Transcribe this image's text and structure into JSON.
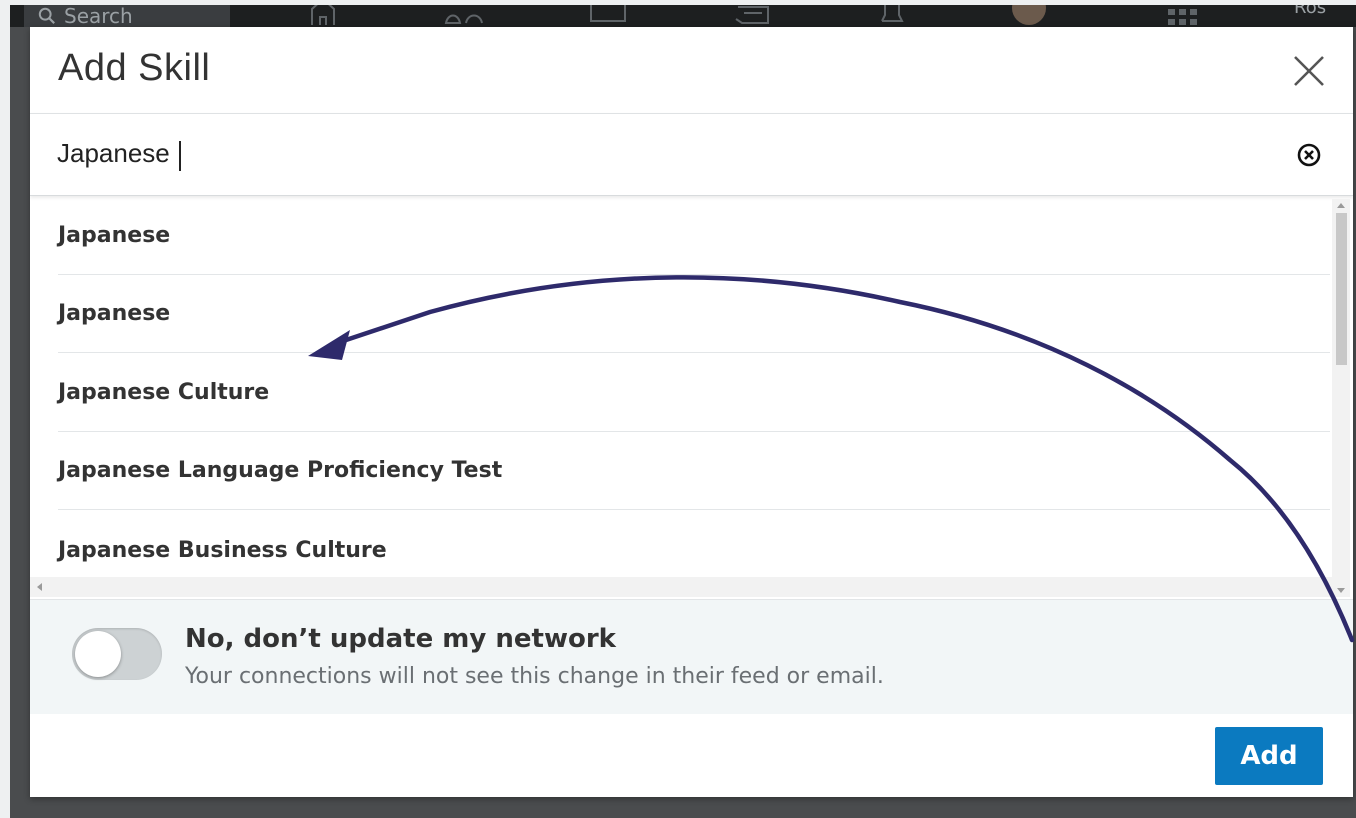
{
  "background": {
    "search_placeholder": "Search",
    "user_label": "Ros"
  },
  "modal": {
    "title": "Add Skill",
    "search": {
      "value": "Japanese"
    },
    "results": [
      {
        "label": "Japanese"
      },
      {
        "label": "Japanese"
      },
      {
        "label": "Japanese Culture"
      },
      {
        "label": "Japanese Language Proficiency Test"
      },
      {
        "label": "Japanese Business Culture"
      }
    ],
    "network": {
      "toggle_on": false,
      "title": "No, don’t update my network",
      "subtitle": "Your connections will not see this change in their feed or email."
    },
    "add_label": "Add"
  },
  "colors": {
    "accent": "#0b7ac0",
    "annotation_arrow": "#2e2a6b",
    "overlay": "#4a4c4e"
  },
  "icons": [
    "search-icon",
    "home-icon",
    "network-icon",
    "jobs-icon",
    "messaging-icon",
    "notifications-icon",
    "avatar",
    "apps-grid-icon",
    "close-icon",
    "clear-circle-icon"
  ]
}
